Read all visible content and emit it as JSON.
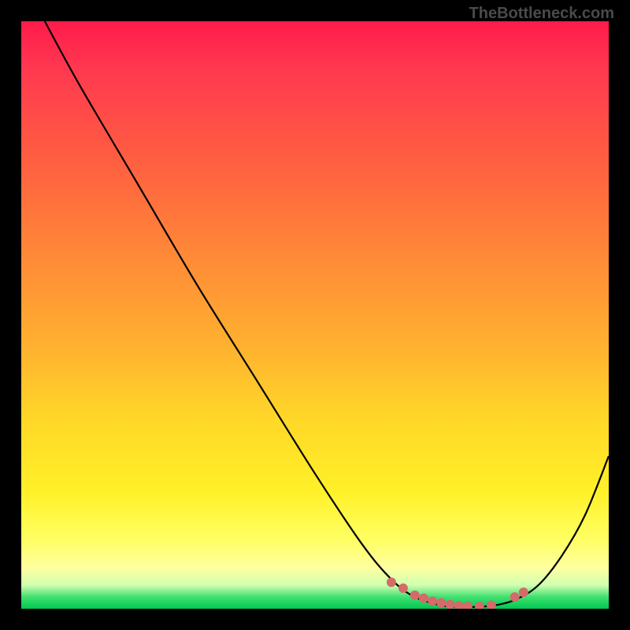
{
  "watermark": "TheBottleneck.com",
  "chart_data": {
    "type": "line",
    "title": "",
    "xlabel": "",
    "ylabel": "",
    "xlim": [
      0,
      100
    ],
    "ylim": [
      0,
      100
    ],
    "gradient_colors": {
      "top": "#ff1a4a",
      "mid1": "#ff8438",
      "mid2": "#ffd828",
      "mid3": "#ffff60",
      "bottom": "#00c850"
    },
    "series": [
      {
        "name": "bottleneck-curve",
        "x": [
          4,
          10,
          20,
          30,
          40,
          50,
          58,
          63,
          67,
          72,
          76,
          80,
          84,
          88,
          92,
          96,
          100
        ],
        "y": [
          100,
          89,
          72,
          55,
          39,
          23,
          11,
          5,
          2,
          0.5,
          0.3,
          0.5,
          1.5,
          4,
          9,
          16,
          26
        ]
      }
    ],
    "markers": {
      "name": "highlight-dots",
      "color": "#d46a6a",
      "x": [
        63,
        65,
        67,
        68.5,
        70,
        71.5,
        73,
        74.5,
        76,
        78,
        80,
        84,
        85.5
      ],
      "y": [
        4.5,
        3.5,
        2.3,
        1.8,
        1.3,
        1.0,
        0.7,
        0.5,
        0.4,
        0.4,
        0.6,
        2.0,
        2.8
      ]
    }
  }
}
